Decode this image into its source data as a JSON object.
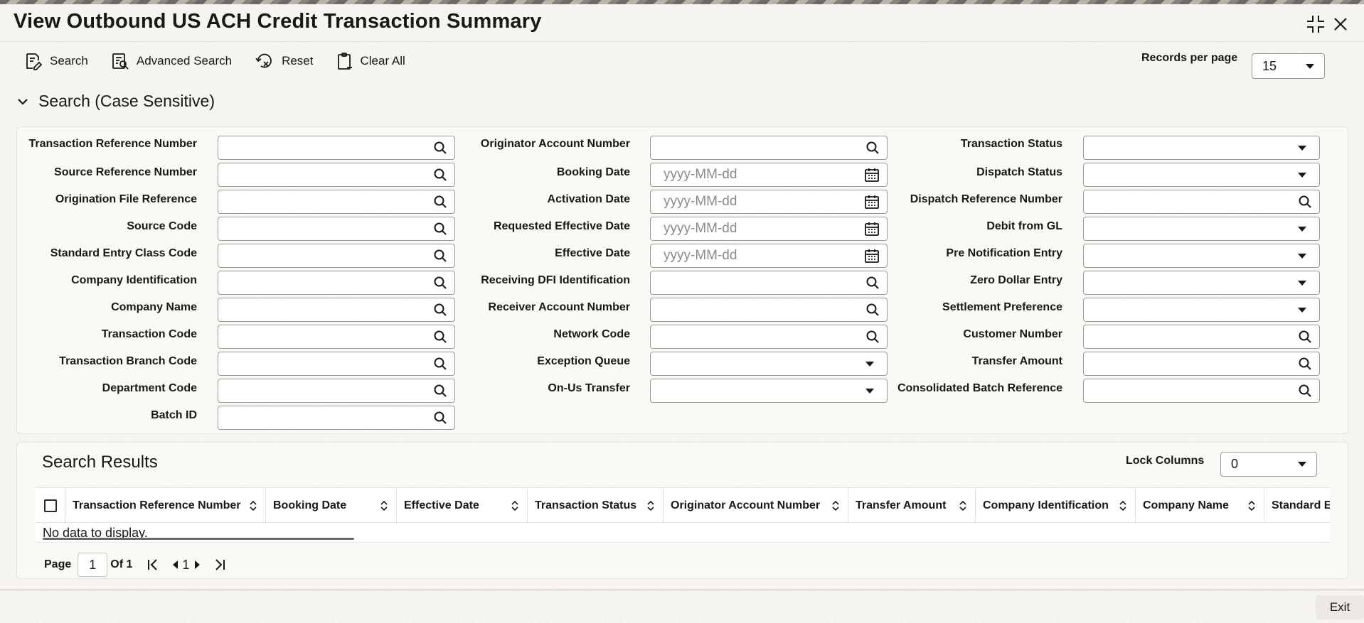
{
  "page": {
    "title": "View Outbound US ACH Credit Transaction Summary"
  },
  "toolbar": {
    "search": "Search",
    "advanced_search": "Advanced Search",
    "reset": "Reset",
    "clear_all": "Clear All"
  },
  "records_per_page": {
    "label": "Records per page",
    "value": "15"
  },
  "search_section": {
    "title": "Search (Case Sensitive)"
  },
  "fields": {
    "col1": [
      {
        "label": "Transaction Reference Number",
        "type": "lookup"
      },
      {
        "label": "Source Reference Number",
        "type": "lookup"
      },
      {
        "label": "Origination File Reference",
        "type": "lookup"
      },
      {
        "label": "Source Code",
        "type": "lookup"
      },
      {
        "label": "Standard Entry Class Code",
        "type": "lookup"
      },
      {
        "label": "Company Identification",
        "type": "lookup"
      },
      {
        "label": "Company Name",
        "type": "lookup"
      },
      {
        "label": "Transaction Code",
        "type": "lookup"
      },
      {
        "label": "Transaction Branch Code",
        "type": "lookup"
      },
      {
        "label": "Department Code",
        "type": "lookup"
      },
      {
        "label": "Batch ID",
        "type": "lookup"
      }
    ],
    "col2": [
      {
        "label": "Originator Account Number",
        "type": "lookup"
      },
      {
        "label": "Booking Date",
        "type": "date",
        "placeholder": "yyyy-MM-dd"
      },
      {
        "label": "Activation Date",
        "type": "date",
        "placeholder": "yyyy-MM-dd"
      },
      {
        "label": "Requested Effective Date",
        "type": "date",
        "placeholder": "yyyy-MM-dd"
      },
      {
        "label": "Effective Date",
        "type": "date",
        "placeholder": "yyyy-MM-dd"
      },
      {
        "label": "Receiving DFI Identification",
        "type": "lookup"
      },
      {
        "label": "Receiver Account Number",
        "type": "lookup"
      },
      {
        "label": "Network Code",
        "type": "lookup"
      },
      {
        "label": "Exception Queue",
        "type": "select"
      },
      {
        "label": "On-Us Transfer",
        "type": "select"
      }
    ],
    "col3": [
      {
        "label": "Transaction Status",
        "type": "select"
      },
      {
        "label": "Dispatch Status",
        "type": "select"
      },
      {
        "label": "Dispatch Reference Number",
        "type": "lookup"
      },
      {
        "label": "Debit from GL",
        "type": "select"
      },
      {
        "label": "Pre Notification Entry",
        "type": "select"
      },
      {
        "label": "Zero Dollar Entry",
        "type": "select"
      },
      {
        "label": "Settlement Preference",
        "type": "select"
      },
      {
        "label": "Customer Number",
        "type": "lookup"
      },
      {
        "label": "Transfer Amount",
        "type": "lookup"
      },
      {
        "label": "Consolidated Batch Reference",
        "type": "lookup"
      }
    ]
  },
  "results": {
    "title": "Search Results",
    "lock_columns_label": "Lock Columns",
    "lock_columns_value": "0",
    "columns": [
      "Transaction Reference Number",
      "Booking Date",
      "Effective Date",
      "Transaction Status",
      "Originator Account Number",
      "Transfer Amount",
      "Company Identification",
      "Company Name",
      "Standard Ent"
    ],
    "empty_message": "No data to display."
  },
  "pager": {
    "page_label": "Page",
    "current": "1",
    "of_label": "Of 1",
    "page_link": "1"
  },
  "footer": {
    "exit": "Exit"
  }
}
